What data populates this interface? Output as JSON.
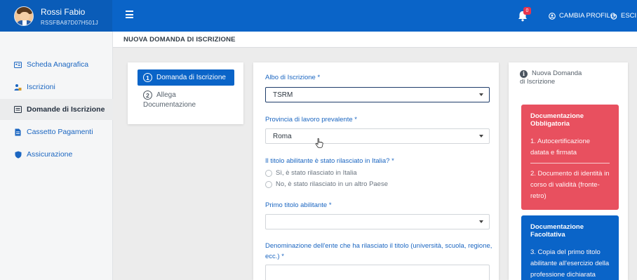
{
  "user": {
    "name": "Rossi Fabio",
    "code": "RSSFBA87D07H501J"
  },
  "topbar": {
    "notifications_count": "0",
    "change_profile_label": "CAMBIA PROFILO",
    "logout_label": "ESCI"
  },
  "sidebar": {
    "items": [
      {
        "label": "Scheda Anagrafica",
        "icon": "id-card-icon"
      },
      {
        "label": "Iscrizioni",
        "icon": "users-icon"
      },
      {
        "label": "Domande di Iscrizione",
        "icon": "form-icon",
        "active": true
      },
      {
        "label": "Cassetto Pagamenti",
        "icon": "file-icon"
      },
      {
        "label": "Assicurazione",
        "icon": "shield-icon"
      }
    ]
  },
  "breadcrumb": "NUOVA DOMANDA DI ISCRIZIONE",
  "steps": [
    {
      "num": "1",
      "label": "Domanda di Iscrizione"
    },
    {
      "num": "2",
      "label_line1": "Allega",
      "label_line2": "Documentazione"
    }
  ],
  "form": {
    "albo": {
      "label": "Albo di Iscrizione *",
      "value": "TSRM"
    },
    "provincia": {
      "label": "Provincia di lavoro prevalente *",
      "value": "Roma"
    },
    "titolo_italia": {
      "label": "Il titolo abilitante è stato rilasciato in Italia? *",
      "options": [
        "Sì, è stato rilasciato in Italia",
        "No, è stato rilasciato in un altro Paese"
      ]
    },
    "primo_titolo": {
      "label": "Primo titolo abilitante *",
      "value": ""
    },
    "ente": {
      "label_line1": "Denominazione dell'ente che ha rilasciato il titolo (università, scuola, regione,",
      "label_line2": "ecc.) *"
    }
  },
  "info": {
    "heading_line1": "Nuova Domanda",
    "heading_line2": "di Iscrizione",
    "mandatory": {
      "title_line1": "Documentazione",
      "title_line2": "Obbligatoria",
      "item1_line1": "1. Autocertificazione",
      "item1_line2": "datata e firmata",
      "item2_line1": "2. Documento di identità in",
      "item2_line2": "corso di validità (fronte-",
      "item2_line3": "retro)",
      "color": "#e8505f"
    },
    "optional": {
      "title_line1": "Documentazione",
      "title_line2": "Facoltativa",
      "item3_line1": "3. Copia del primo titolo",
      "item3_line2": "abilitante all'esercizio della",
      "item3_line3": "professione dichiarata",
      "color": "#0a64c8"
    }
  },
  "colors": {
    "brand_blue": "#0a64c8",
    "danger_red": "#e8505f",
    "link_blue": "#1b66c1"
  }
}
